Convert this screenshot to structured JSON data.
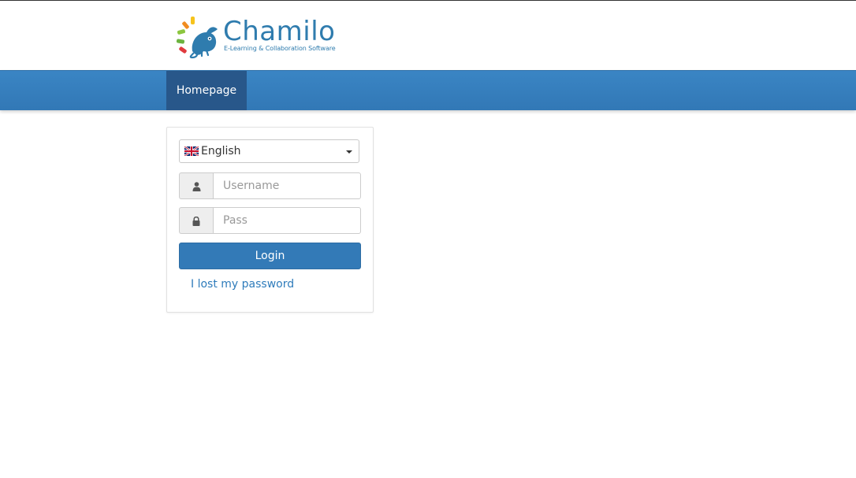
{
  "brand": {
    "name": "Chamilo",
    "tagline": "E-Learning & Collaboration Software"
  },
  "nav": {
    "items": [
      {
        "label": "Homepage",
        "active": true
      }
    ]
  },
  "login": {
    "language": {
      "selected": "English"
    },
    "username": {
      "placeholder": "Username",
      "value": ""
    },
    "password": {
      "placeholder": "Pass",
      "value": ""
    },
    "submit_label": "Login",
    "lost_password_label": "I lost my password"
  },
  "icons": {
    "username": "user-icon",
    "password": "lock-icon",
    "language_flag": "uk-flag-icon",
    "dropdown": "caret-down-icon"
  },
  "colors": {
    "brand_blue": "#2f7cae",
    "navbar": "#337ab7",
    "nav_active": "#28578a",
    "button_primary": "#337ab7",
    "link": "#2f7cbb"
  }
}
